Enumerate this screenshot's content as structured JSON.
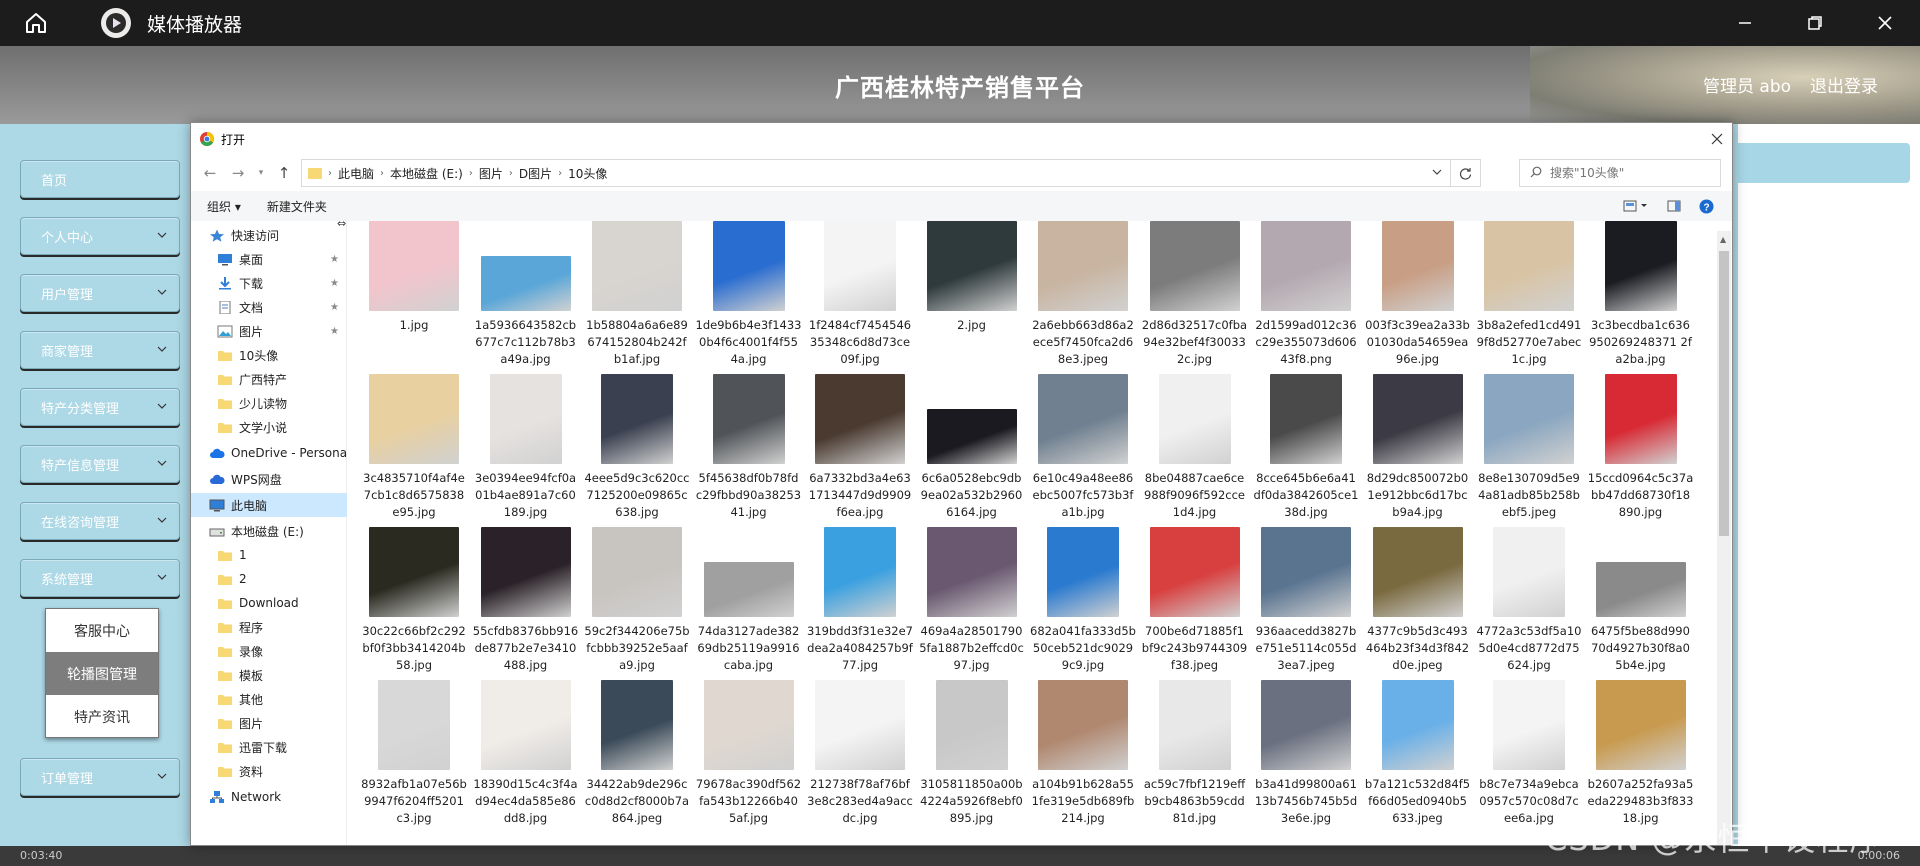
{
  "titlebar": {
    "app_title": "媒体播放器",
    "home_icon": "home-icon",
    "play_icon": "play-circle-icon"
  },
  "header": {
    "site_title": "广西桂林特产销售平台",
    "admin_label": "管理员 abo",
    "logout_label": "退出登录"
  },
  "sidebar": {
    "items": [
      {
        "label": "首页",
        "has_chevron": false
      },
      {
        "label": "个人中心",
        "has_chevron": true
      },
      {
        "label": "用户管理",
        "has_chevron": true
      },
      {
        "label": "商家管理",
        "has_chevron": true
      },
      {
        "label": "特产分类管理",
        "has_chevron": true
      },
      {
        "label": "特产信息管理",
        "has_chevron": true
      },
      {
        "label": "在线咨询管理",
        "has_chevron": true
      },
      {
        "label": "系统管理",
        "has_chevron": true
      },
      {
        "label": "订单管理",
        "has_chevron": true
      }
    ],
    "submenu": [
      {
        "label": "客服中心",
        "active": false
      },
      {
        "label": "轮播图管理",
        "active": true
      },
      {
        "label": "特产资讯",
        "active": false
      }
    ]
  },
  "dialog": {
    "title": "打开",
    "breadcrumb": [
      "此电脑",
      "本地磁盘 (E:)",
      "图片",
      "D图片",
      "10头像"
    ],
    "search_placeholder": "搜索\"10头像\"",
    "toolbar": {
      "organize": "组织 ▾",
      "new_folder": "新建文件夹"
    },
    "nav": [
      {
        "label": "快速访问",
        "type": "star",
        "indent": 1,
        "pin": false
      },
      {
        "label": "桌面",
        "type": "desktop",
        "indent": 2,
        "pin": true
      },
      {
        "label": "下载",
        "type": "download",
        "indent": 2,
        "pin": true
      },
      {
        "label": "文档",
        "type": "doc",
        "indent": 2,
        "pin": true
      },
      {
        "label": "图片",
        "type": "pic",
        "indent": 2,
        "pin": true
      },
      {
        "label": "10头像",
        "type": "folder",
        "indent": 2,
        "pin": false
      },
      {
        "label": "广西特产",
        "type": "folder",
        "indent": 2,
        "pin": false
      },
      {
        "label": "少儿读物",
        "type": "folder",
        "indent": 2,
        "pin": false
      },
      {
        "label": "文学小说",
        "type": "folder",
        "indent": 2,
        "pin": false
      },
      {
        "label": "",
        "type": "gap",
        "indent": 0,
        "pin": false
      },
      {
        "label": "OneDrive - Personal",
        "type": "cloud",
        "indent": 1,
        "pin": false
      },
      {
        "label": "",
        "type": "gap",
        "indent": 0,
        "pin": false
      },
      {
        "label": "WPS网盘",
        "type": "cloud2",
        "indent": 1,
        "pin": false
      },
      {
        "label": "",
        "type": "gap",
        "indent": 0,
        "pin": false
      },
      {
        "label": "此电脑",
        "type": "pc",
        "indent": 1,
        "pin": false,
        "selected": true
      },
      {
        "label": "",
        "type": "gap",
        "indent": 0,
        "pin": false
      },
      {
        "label": "本地磁盘 (E:)",
        "type": "drive",
        "indent": 1,
        "pin": false
      },
      {
        "label": "1",
        "type": "folder",
        "indent": 2,
        "pin": false
      },
      {
        "label": "2",
        "type": "folder",
        "indent": 2,
        "pin": false
      },
      {
        "label": "Download",
        "type": "folder",
        "indent": 2,
        "pin": false
      },
      {
        "label": "程序",
        "type": "folder",
        "indent": 2,
        "pin": false
      },
      {
        "label": "录像",
        "type": "folder",
        "indent": 2,
        "pin": false
      },
      {
        "label": "模板",
        "type": "folder",
        "indent": 2,
        "pin": false
      },
      {
        "label": "其他",
        "type": "folder",
        "indent": 2,
        "pin": false
      },
      {
        "label": "图片",
        "type": "folder",
        "indent": 2,
        "pin": false
      },
      {
        "label": "迅雷下载",
        "type": "folder",
        "indent": 2,
        "pin": false
      },
      {
        "label": "资料",
        "type": "folder",
        "indent": 2,
        "pin": false
      },
      {
        "label": "",
        "type": "gap",
        "indent": 0,
        "pin": false
      },
      {
        "label": "Network",
        "type": "net",
        "indent": 1,
        "pin": false
      }
    ],
    "files": [
      [
        {
          "name": "1.jpg",
          "color": "#f2c4cc",
          "shape": "tall"
        },
        {
          "name": "1a5936643582cb677c7c112b78b3a49a.jpg",
          "color": "#5aa6d8",
          "shape": "wide"
        },
        {
          "name": "1b58804a6a6e89674152804b242fb1af.jpg",
          "color": "#d8d4d0",
          "shape": "tall"
        },
        {
          "name": "1de9b6b4e3f14330b4f6c4001f4f554a.jpg",
          "color": "#2a6dd0",
          "shape": "portrait"
        },
        {
          "name": "1f2484cf745454635348c6d8d73ce09f.jpg",
          "color": "#f4f4f4",
          "shape": "portrait"
        },
        {
          "name": "2.jpg",
          "color": "#2e3a3c",
          "shape": "tall"
        },
        {
          "name": "2a6ebb663d86a2ece5f7450fca2d68e3.jpeg",
          "color": "#c8b4a0",
          "shape": "tall"
        },
        {
          "name": "2d86d32517c0fba94e32bef4f300332c.jpg",
          "color": "#7c7c7c",
          "shape": "tall"
        },
        {
          "name": "2d1599ad012c36c29e355073d60643f8.png",
          "color": "#b4a8b0",
          "shape": "tall"
        },
        {
          "name": "003f3c39ea2a33b01030da54659ea96e.jpg",
          "color": "#c89e84",
          "shape": "portrait"
        },
        {
          "name": "3b8a2efed1cd4919f8d52770e7abec1c.jpg",
          "color": "#d8c4a4",
          "shape": "tall"
        },
        {
          "name": "3c3becdba1c636950269248371 2fa2ba.jpg",
          "color": "#1a1c22",
          "shape": "portrait"
        }
      ],
      [
        {
          "name": "3c4835710f4af4e7cb1c8d6575838e95.jpg",
          "color": "#e8d0a0",
          "shape": "tall"
        },
        {
          "name": "3e0394ee94fcf0a01b4ae891a7c60189.jpg",
          "color": "#e6e2e0",
          "shape": "portrait"
        },
        {
          "name": "4eee5d9c3c620cc7125200e09865c638.jpg",
          "color": "#3a4050",
          "shape": "portrait"
        },
        {
          "name": "5f45638df0b78fdc29fbbd90a3825341.jpg",
          "color": "#505458",
          "shape": "portrait"
        },
        {
          "name": "6a7332bd3a4e631713447d9d9909f6ea.jpg",
          "color": "#4a3a30",
          "shape": "tall"
        },
        {
          "name": "6c6a0528ebc9db9ea02a532b29606164.jpg",
          "color": "#1a1a20",
          "shape": "wide"
        },
        {
          "name": "6e10c49a48ee86ebc5007fc573b3fa1b.jpg",
          "color": "#708090",
          "shape": "tall"
        },
        {
          "name": "8be04887cae6ce988f9096f592cce1d4.jpg",
          "color": "#f0f0f0",
          "shape": "portrait"
        },
        {
          "name": "8cce645b6e6a41df0da3842605ce138d.jpg",
          "color": "#4a4a4a",
          "shape": "portrait"
        },
        {
          "name": "8d29dc850072b01e912bbc6d17bcb9a4.jpg",
          "color": "#3c3a44",
          "shape": "tall"
        },
        {
          "name": "8e8e130709d5e94a81adb85b258bebf5.jpeg",
          "color": "#8aa6c0",
          "shape": "tall"
        },
        {
          "name": "15ccd0964c5c37abb47dd68730f18890.jpg",
          "color": "#d82a34",
          "shape": "portrait"
        }
      ],
      [
        {
          "name": "30c22c66bf2c292bf0f3bb3414204b58.jpg",
          "color": "#2a2a20",
          "shape": "tall"
        },
        {
          "name": "55cfdb8376bb916de877b2e7e3410488.jpg",
          "color": "#2a2228",
          "shape": "tall"
        },
        {
          "name": "59c2f344206e75bfcbbb39252e5aafa9.jpg",
          "color": "#c8c4c0",
          "shape": "tall"
        },
        {
          "name": "74da3127ade38269db25119a9916caba.jpg",
          "color": "#a0a0a0",
          "shape": "wide"
        },
        {
          "name": "319bdd3f31e32e7dea2a4084257b9f77.jpg",
          "color": "#3aa0e0",
          "shape": "portrait"
        },
        {
          "name": "469a4a285017905fa1887b2effcd0c97.jpg",
          "color": "#6a5870",
          "shape": "tall"
        },
        {
          "name": "682a041fa333d5b50ceb521dc90299c9.jpg",
          "color": "#2a7ad0",
          "shape": "portrait"
        },
        {
          "name": "700be6d71885f1bf9c243b9744309f38.jpeg",
          "color": "#d84040",
          "shape": "tall"
        },
        {
          "name": "936aacedd3827be751e5114c055d3ea7.jpeg",
          "color": "#5a7490",
          "shape": "tall"
        },
        {
          "name": "4377c9b5d3c493464b23f34d3f842d0e.jpeg",
          "color": "#7a6a40",
          "shape": "tall"
        },
        {
          "name": "4772a3c53df5a105d0e4cd8772d75624.jpg",
          "color": "#f0f0f0",
          "shape": "portrait"
        },
        {
          "name": "6475f5be88d99070d4927b30f8a05b4e.jpg",
          "color": "#8a8a8a",
          "shape": "wide"
        }
      ],
      [
        {
          "name": "8932afb1a07e56b9947f6204ff5201c3.jpg",
          "color": "#d8d8d8",
          "shape": "portrait"
        },
        {
          "name": "18390d15c4c3f4ad94ec4da585e86dd8.jpg",
          "color": "#f0ece8",
          "shape": "tall"
        },
        {
          "name": "34422ab9de296cc0d8d2cf8000b7a864.jpeg",
          "color": "#3a4a58",
          "shape": "portrait"
        },
        {
          "name": "79678ac390df562fa543b12266b405af.jpg",
          "color": "#e0d8d0",
          "shape": "tall"
        },
        {
          "name": "212738f78af76bf3e8c283ed4a9accdc.jpg",
          "color": "#f4f4f4",
          "shape": "tall"
        },
        {
          "name": "3105811850a00b4224a5926f8ebf0895.jpg",
          "color": "#c8c8c8",
          "shape": "portrait"
        },
        {
          "name": "a104b91b628a551fe319e5db689fb214.jpg",
          "color": "#b08870",
          "shape": "tall"
        },
        {
          "name": "ac59c7fbf1219effb9cb4863b59cdd81d.jpg",
          "color": "#e8e8e8",
          "shape": "portrait"
        },
        {
          "name": "b3a41d99800a6113b7456b745b5d3e6e.jpg",
          "color": "#6a7080",
          "shape": "tall"
        },
        {
          "name": "b7a121c532d84f5f66d05ed0940b5633.jpeg",
          "color": "#6ab0e8",
          "shape": "portrait"
        },
        {
          "name": "b8c7e734a9ebca0957c570c08d7cee6a.jpg",
          "color": "#f4f4f4",
          "shape": "portrait"
        },
        {
          "name": "b2607a252fa93a5eda229483b3f83318.jpg",
          "color": "#c89a50",
          "shape": "tall"
        }
      ]
    ]
  },
  "bottom": {
    "left_time": "0:03:40",
    "right_time": "0:00:06"
  },
  "watermark": "CSDN @永恒毕设程序"
}
